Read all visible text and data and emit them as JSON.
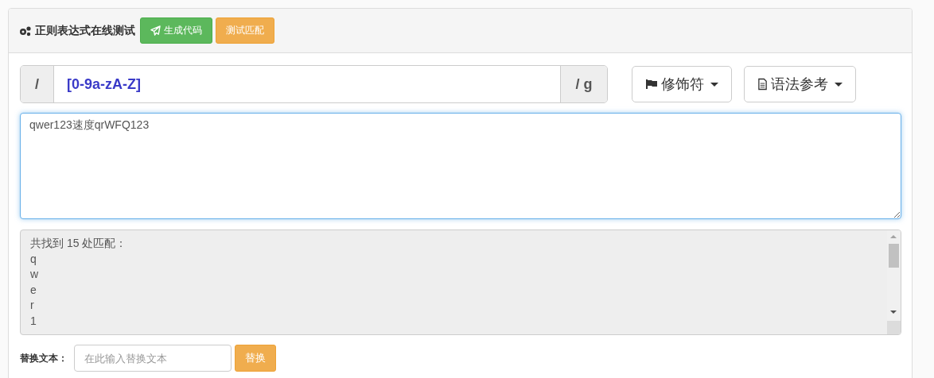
{
  "panel": {
    "title": "正则表达式在线测试",
    "buttons": [
      {
        "label": "生成代码",
        "kind": "success"
      },
      {
        "label": "测试匹配",
        "kind": "warning"
      }
    ]
  },
  "regex": {
    "prefix": "/",
    "value": "[0-9a-zA-Z]",
    "suffix": "/ g"
  },
  "dropdowns": [
    {
      "label": "修饰符",
      "kind": "flag"
    },
    {
      "label": "语法参考",
      "kind": "doc"
    }
  ],
  "source_text": "qwer123速度qrWFQ123",
  "result": {
    "summary": "共找到 15 处匹配：",
    "lines": [
      "q",
      "w",
      "e",
      "r",
      "1"
    ]
  },
  "replace": {
    "label": "替换文本：",
    "placeholder": "在此输入替换文本",
    "button": "替换"
  }
}
